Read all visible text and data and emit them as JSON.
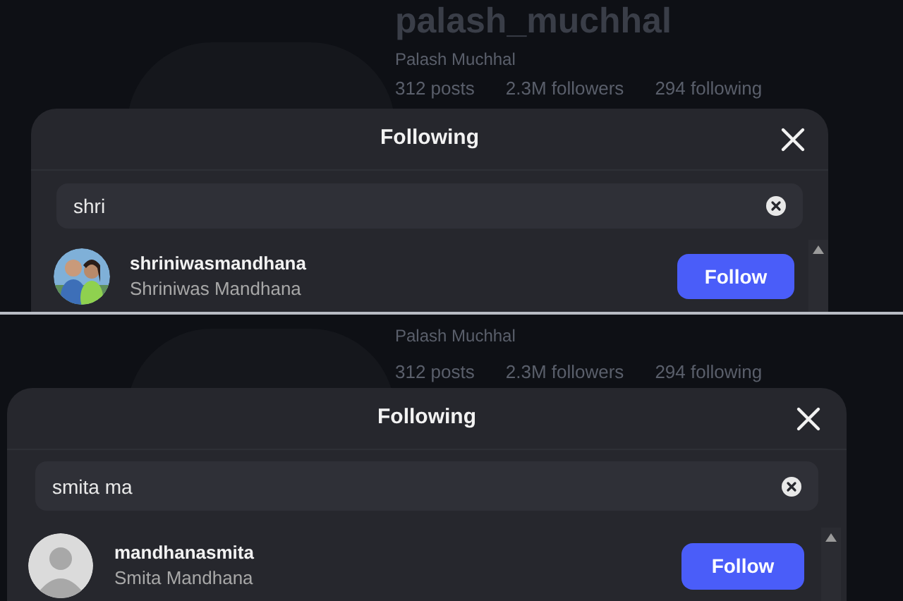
{
  "screenshots": [
    {
      "profile": {
        "username": "palash_muchhal",
        "name": "Palash Muchhal",
        "stats": [
          "312 posts",
          "2.3M followers",
          "294 following"
        ]
      },
      "dialog": {
        "title": "Following",
        "search": {
          "value": "shri"
        },
        "results": [
          {
            "username": "shriniwasmandhana",
            "full_name": "Shriniwas Mandhana",
            "button": "Follow"
          }
        ]
      }
    },
    {
      "profile": {
        "name": "Palash Muchhal",
        "stats": [
          "312 posts",
          "2.3M followers",
          "294 following"
        ]
      },
      "dialog": {
        "title": "Following",
        "search": {
          "value": "smita ma"
        },
        "results": [
          {
            "username": "mandhanasmita",
            "full_name": "Smita Mandhana",
            "kind": "default",
            "button": "Follow"
          }
        ]
      }
    }
  ]
}
